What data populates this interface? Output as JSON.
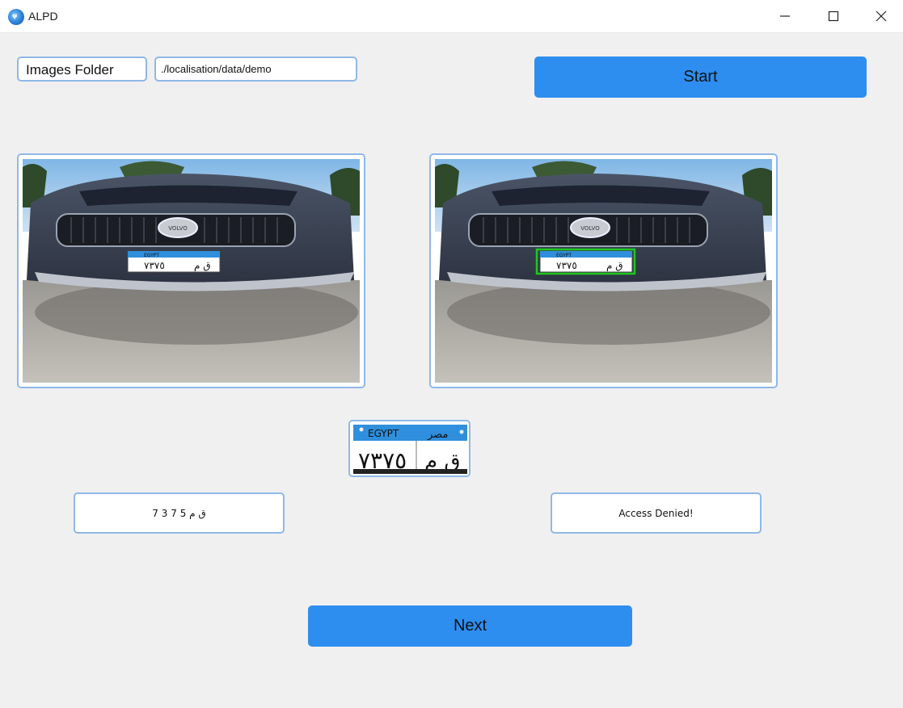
{
  "window": {
    "title": "ALPD",
    "app_icon_glyph": "ψ",
    "controls": [
      "minimize-icon",
      "maximize-icon",
      "close-icon"
    ]
  },
  "toolbar": {
    "folder_label": "Images Folder",
    "folder_path": "./localisation/data/demo",
    "start_label": "Start"
  },
  "images": {
    "plate_country_en": "EGYPT",
    "plate_country_ar": "مصر",
    "plate_number_ar": "٧٣٧٥",
    "plate_letters_ar": "ق م",
    "car_badge": "VOLVO",
    "detection_box_color": "#1ec81e"
  },
  "results": {
    "plate_text": "ق م 5 7 3 7",
    "status": "Access Denied!"
  },
  "footer": {
    "next_label": "Next"
  },
  "colors": {
    "accent": "#2d8ef0",
    "border": "#8fb8e8",
    "background": "#f0f0f0"
  }
}
